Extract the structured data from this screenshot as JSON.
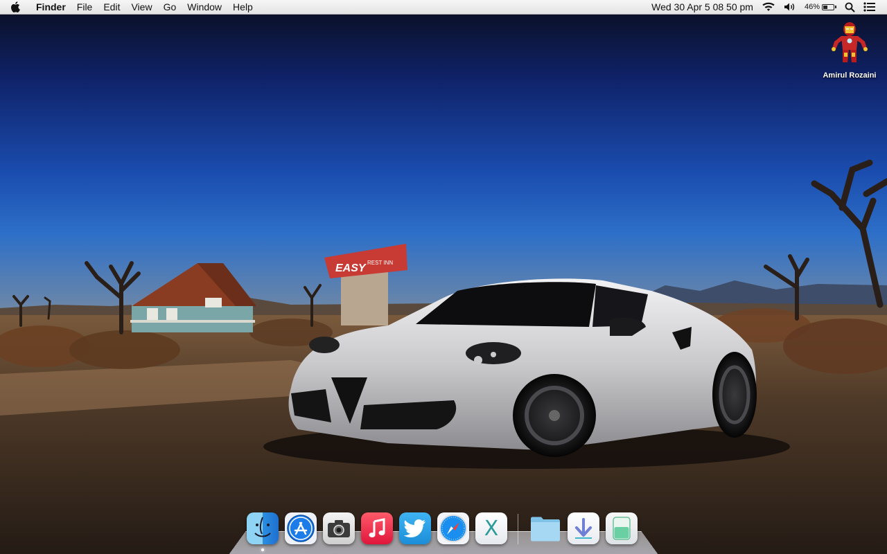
{
  "menubar": {
    "app_name": "Finder",
    "items": [
      "File",
      "Edit",
      "View",
      "Go",
      "Window",
      "Help"
    ],
    "icons": {
      "apple": "apple-logo-icon",
      "wifi": "wifi-icon",
      "volume": "volume-icon",
      "battery": "battery-icon",
      "spotlight": "search-icon",
      "notifications": "notification-center-icon"
    },
    "clock": "Wed 30 Apr  5 08 50 pm",
    "battery_percent": "46%",
    "battery_level": 0.46
  },
  "desktop": {
    "shortcut": {
      "label": "Amirul Rozaini",
      "icon": "iron-man-icon"
    },
    "wallpaper": {
      "sign_text": "EASY",
      "sign_subtext": "REST INN"
    }
  },
  "dock": {
    "apps": [
      {
        "name": "finder",
        "icon": "finder-icon",
        "running": true
      },
      {
        "name": "app-store",
        "icon": "app-store-icon",
        "running": false
      },
      {
        "name": "screenshot",
        "icon": "camera-icon",
        "running": false
      },
      {
        "name": "itunes",
        "icon": "music-note-icon",
        "running": false
      },
      {
        "name": "twitter",
        "icon": "twitter-bird-icon",
        "running": false
      },
      {
        "name": "safari",
        "icon": "safari-compass-icon",
        "running": false
      },
      {
        "name": "os-x-installer",
        "icon": "x-letter-icon",
        "running": false
      }
    ],
    "stacks": [
      {
        "name": "applications-folder",
        "icon": "folder-icon"
      },
      {
        "name": "downloads",
        "icon": "download-arrow-icon"
      },
      {
        "name": "trash",
        "icon": "trash-icon"
      }
    ],
    "glyphs": {
      "x": "X"
    }
  },
  "colors": {
    "sky_top": "#0b0f1f",
    "sky_mid": "#1b4fb3",
    "menubar": "#ececec",
    "car": "#d8d8da"
  }
}
